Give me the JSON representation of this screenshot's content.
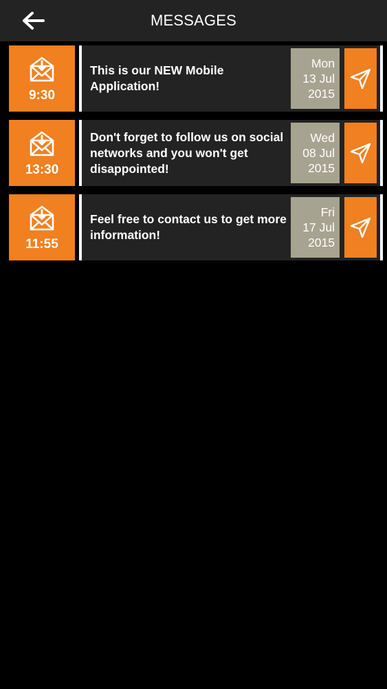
{
  "header": {
    "title": "MESSAGES",
    "back_icon": "back-arrow-icon"
  },
  "colors": {
    "accent": "#f08020",
    "header_bg": "#232323",
    "card_bg": "#232323",
    "date_bg": "#a6a390",
    "background": "#000000"
  },
  "messages": [
    {
      "time": "9:30",
      "text": "This is our NEW Mobile Application!",
      "date": {
        "weekday": "Mon",
        "day_month": "13 Jul",
        "year": "2015"
      },
      "icon": "envelope-download-icon",
      "action_icon": "send-icon"
    },
    {
      "time": "13:30",
      "text": "Don't forget to follow us on social networks and you won't get disappointed!",
      "date": {
        "weekday": "Wed",
        "day_month": "08 Jul",
        "year": "2015"
      },
      "icon": "envelope-download-icon",
      "action_icon": "send-icon"
    },
    {
      "time": "11:55",
      "text": "Feel free to contact us to get more information!",
      "date": {
        "weekday": "Fri",
        "day_month": "17 Jul",
        "year": "2015"
      },
      "icon": "envelope-download-icon",
      "action_icon": "send-icon"
    }
  ]
}
